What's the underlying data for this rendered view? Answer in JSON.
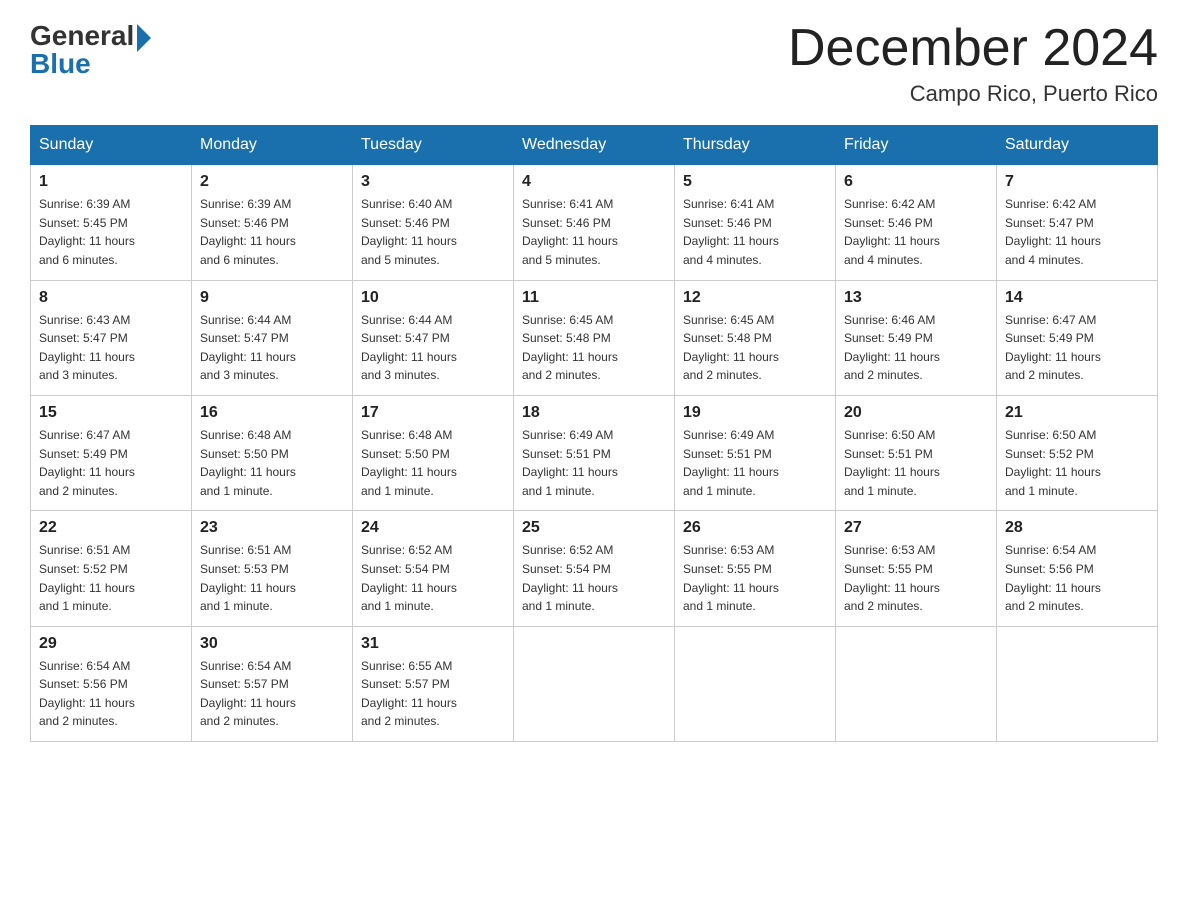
{
  "logo": {
    "text1": "General",
    "text2": "Blue"
  },
  "title": "December 2024",
  "location": "Campo Rico, Puerto Rico",
  "days_of_week": [
    "Sunday",
    "Monday",
    "Tuesday",
    "Wednesday",
    "Thursday",
    "Friday",
    "Saturday"
  ],
  "weeks": [
    [
      {
        "day": "1",
        "info": "Sunrise: 6:39 AM\nSunset: 5:45 PM\nDaylight: 11 hours\nand 6 minutes."
      },
      {
        "day": "2",
        "info": "Sunrise: 6:39 AM\nSunset: 5:46 PM\nDaylight: 11 hours\nand 6 minutes."
      },
      {
        "day": "3",
        "info": "Sunrise: 6:40 AM\nSunset: 5:46 PM\nDaylight: 11 hours\nand 5 minutes."
      },
      {
        "day": "4",
        "info": "Sunrise: 6:41 AM\nSunset: 5:46 PM\nDaylight: 11 hours\nand 5 minutes."
      },
      {
        "day": "5",
        "info": "Sunrise: 6:41 AM\nSunset: 5:46 PM\nDaylight: 11 hours\nand 4 minutes."
      },
      {
        "day": "6",
        "info": "Sunrise: 6:42 AM\nSunset: 5:46 PM\nDaylight: 11 hours\nand 4 minutes."
      },
      {
        "day": "7",
        "info": "Sunrise: 6:42 AM\nSunset: 5:47 PM\nDaylight: 11 hours\nand 4 minutes."
      }
    ],
    [
      {
        "day": "8",
        "info": "Sunrise: 6:43 AM\nSunset: 5:47 PM\nDaylight: 11 hours\nand 3 minutes."
      },
      {
        "day": "9",
        "info": "Sunrise: 6:44 AM\nSunset: 5:47 PM\nDaylight: 11 hours\nand 3 minutes."
      },
      {
        "day": "10",
        "info": "Sunrise: 6:44 AM\nSunset: 5:47 PM\nDaylight: 11 hours\nand 3 minutes."
      },
      {
        "day": "11",
        "info": "Sunrise: 6:45 AM\nSunset: 5:48 PM\nDaylight: 11 hours\nand 2 minutes."
      },
      {
        "day": "12",
        "info": "Sunrise: 6:45 AM\nSunset: 5:48 PM\nDaylight: 11 hours\nand 2 minutes."
      },
      {
        "day": "13",
        "info": "Sunrise: 6:46 AM\nSunset: 5:49 PM\nDaylight: 11 hours\nand 2 minutes."
      },
      {
        "day": "14",
        "info": "Sunrise: 6:47 AM\nSunset: 5:49 PM\nDaylight: 11 hours\nand 2 minutes."
      }
    ],
    [
      {
        "day": "15",
        "info": "Sunrise: 6:47 AM\nSunset: 5:49 PM\nDaylight: 11 hours\nand 2 minutes."
      },
      {
        "day": "16",
        "info": "Sunrise: 6:48 AM\nSunset: 5:50 PM\nDaylight: 11 hours\nand 1 minute."
      },
      {
        "day": "17",
        "info": "Sunrise: 6:48 AM\nSunset: 5:50 PM\nDaylight: 11 hours\nand 1 minute."
      },
      {
        "day": "18",
        "info": "Sunrise: 6:49 AM\nSunset: 5:51 PM\nDaylight: 11 hours\nand 1 minute."
      },
      {
        "day": "19",
        "info": "Sunrise: 6:49 AM\nSunset: 5:51 PM\nDaylight: 11 hours\nand 1 minute."
      },
      {
        "day": "20",
        "info": "Sunrise: 6:50 AM\nSunset: 5:51 PM\nDaylight: 11 hours\nand 1 minute."
      },
      {
        "day": "21",
        "info": "Sunrise: 6:50 AM\nSunset: 5:52 PM\nDaylight: 11 hours\nand 1 minute."
      }
    ],
    [
      {
        "day": "22",
        "info": "Sunrise: 6:51 AM\nSunset: 5:52 PM\nDaylight: 11 hours\nand 1 minute."
      },
      {
        "day": "23",
        "info": "Sunrise: 6:51 AM\nSunset: 5:53 PM\nDaylight: 11 hours\nand 1 minute."
      },
      {
        "day": "24",
        "info": "Sunrise: 6:52 AM\nSunset: 5:54 PM\nDaylight: 11 hours\nand 1 minute."
      },
      {
        "day": "25",
        "info": "Sunrise: 6:52 AM\nSunset: 5:54 PM\nDaylight: 11 hours\nand 1 minute."
      },
      {
        "day": "26",
        "info": "Sunrise: 6:53 AM\nSunset: 5:55 PM\nDaylight: 11 hours\nand 1 minute."
      },
      {
        "day": "27",
        "info": "Sunrise: 6:53 AM\nSunset: 5:55 PM\nDaylight: 11 hours\nand 2 minutes."
      },
      {
        "day": "28",
        "info": "Sunrise: 6:54 AM\nSunset: 5:56 PM\nDaylight: 11 hours\nand 2 minutes."
      }
    ],
    [
      {
        "day": "29",
        "info": "Sunrise: 6:54 AM\nSunset: 5:56 PM\nDaylight: 11 hours\nand 2 minutes."
      },
      {
        "day": "30",
        "info": "Sunrise: 6:54 AM\nSunset: 5:57 PM\nDaylight: 11 hours\nand 2 minutes."
      },
      {
        "day": "31",
        "info": "Sunrise: 6:55 AM\nSunset: 5:57 PM\nDaylight: 11 hours\nand 2 minutes."
      },
      {
        "day": "",
        "info": ""
      },
      {
        "day": "",
        "info": ""
      },
      {
        "day": "",
        "info": ""
      },
      {
        "day": "",
        "info": ""
      }
    ]
  ]
}
